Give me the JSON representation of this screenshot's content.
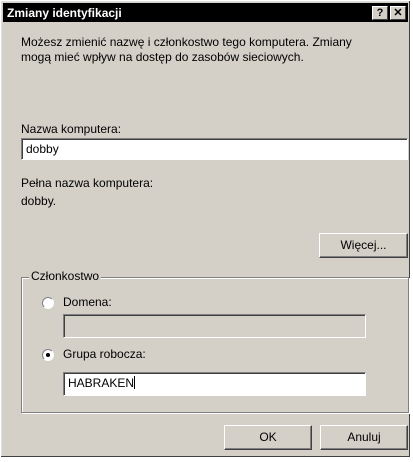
{
  "window": {
    "title": "Zmiany identyfikacji",
    "help_button": "?",
    "close_button": "✕"
  },
  "description": {
    "line1": "Możesz zmienić nazwę i członkostwo tego komputera. Zmiany",
    "line2": "mogą mieć wpływ na dostęp do zasobów sieciowych."
  },
  "computer_name": {
    "label": "Nazwa komputera:",
    "value": "dobby"
  },
  "full_name": {
    "label": "Pełna nazwa komputera:",
    "value": "dobby."
  },
  "more_button": "Więcej...",
  "membership": {
    "legend": "Członkostwo",
    "domain": {
      "label": "Domena:",
      "selected": false,
      "value": ""
    },
    "workgroup": {
      "label": "Grupa robocza:",
      "selected": true,
      "value": "HABRAKEN"
    }
  },
  "buttons": {
    "ok": "OK",
    "cancel": "Anuluj"
  }
}
